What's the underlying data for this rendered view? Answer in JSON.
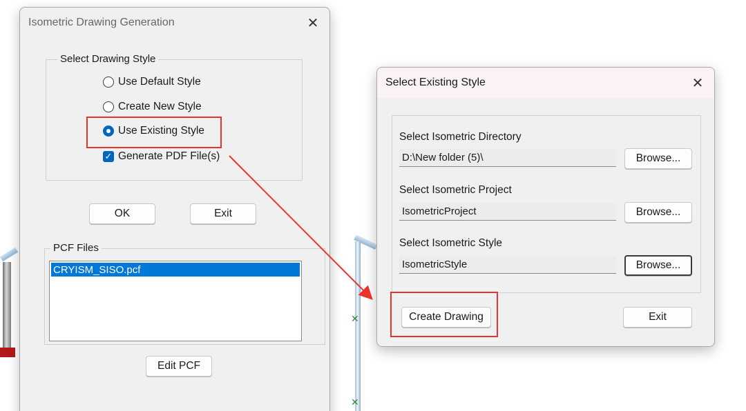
{
  "dialog_iso": {
    "title": "Isometric Drawing Generation",
    "style_group_label": "Select Drawing Style",
    "options": [
      {
        "label": "Use Default Style",
        "checked": false
      },
      {
        "label": "Create New Style",
        "checked": false
      },
      {
        "label": "Use Existing Style",
        "checked": true
      }
    ],
    "generate_pdf_label": "Generate PDF File(s)",
    "generate_pdf_checked": true,
    "ok_label": "OK",
    "exit_label": "Exit",
    "pcf_group_label": "PCF Files",
    "pcf_files": [
      "CRYISM_SISO.pcf"
    ],
    "edit_pcf_label": "Edit PCF"
  },
  "dialog_select": {
    "title": "Select Existing Style",
    "directory_label": "Select Isometric Directory",
    "directory_value": "D:\\New folder (5)\\",
    "project_label": "Select Isometric Project",
    "project_value": "IsometricProject",
    "style_label": "Select Isometric Style",
    "style_value": "IsometricStyle",
    "browse_label": "Browse...",
    "create_drawing_label": "Create Drawing",
    "exit_label": "Exit"
  },
  "icons": {
    "close": "close-icon",
    "check": "checkmark-icon"
  },
  "colors": {
    "highlight": "#e8342b",
    "accent": "#0067c0",
    "selection": "#0078d7"
  }
}
